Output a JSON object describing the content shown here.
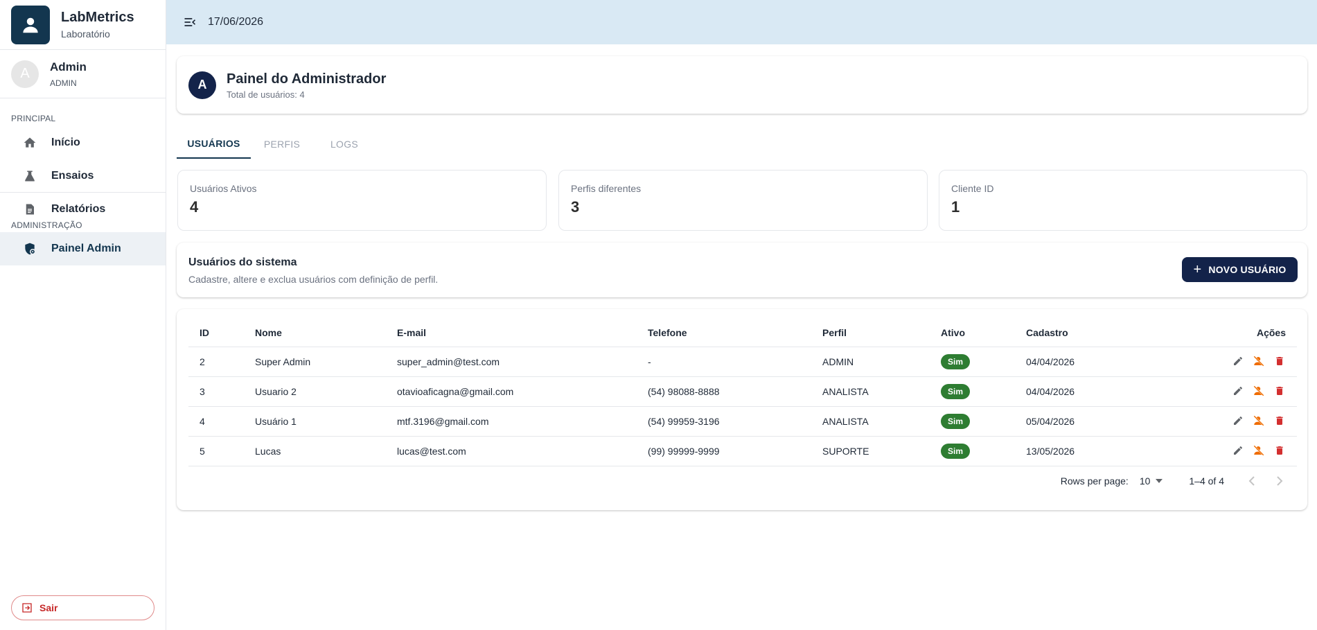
{
  "brand": {
    "title": "LabMetrics",
    "subtitle": "Laboratório",
    "icon": "person-icon"
  },
  "user": {
    "avatar_letter": "A",
    "name": "Admin",
    "role": "ADMIN"
  },
  "sidebar": {
    "sections": [
      {
        "title": "PRINCIPAL",
        "items": [
          {
            "label": "Início",
            "icon": "home-icon"
          },
          {
            "label": "Ensaios",
            "icon": "flask-icon"
          },
          {
            "label": "Relatórios",
            "icon": "document-icon"
          }
        ]
      },
      {
        "title": "ADMINISTRAÇÃO",
        "items": [
          {
            "label": "Painel Admin",
            "icon": "admin-shield-icon",
            "active": true
          }
        ]
      }
    ],
    "logout_label": "Sair"
  },
  "topbar": {
    "date": "17/06/2026"
  },
  "header": {
    "avatar_letter": "A",
    "title": "Painel do Administrador",
    "subtitle": "Total de usuários: 4"
  },
  "tabs": [
    {
      "label": "USUÁRIOS",
      "active": true
    },
    {
      "label": "PERFIS",
      "active": false
    },
    {
      "label": "LOGS",
      "active": false
    }
  ],
  "stats": [
    {
      "label": "Usuários Ativos",
      "value": "4"
    },
    {
      "label": "Perfis diferentes",
      "value": "3"
    },
    {
      "label": "Cliente ID",
      "value": "1"
    }
  ],
  "system_users": {
    "title": "Usuários do sistema",
    "subtitle": "Cadastre, altere e exclua usuários com definição de perfil.",
    "new_button": "NOVO USUÁRIO"
  },
  "table": {
    "headers": [
      "ID",
      "Nome",
      "E-mail",
      "Telefone",
      "Perfil",
      "Ativo",
      "Cadastro",
      "Ações"
    ],
    "rows": [
      {
        "id": "2",
        "nome": "Super Admin",
        "email": "super_admin@test.com",
        "telefone": "-",
        "perfil": "ADMIN",
        "ativo": "Sim",
        "cadastro": "04/04/2026"
      },
      {
        "id": "3",
        "nome": "Usuario 2",
        "email": "otavioaficagna@gmail.com",
        "telefone": "(54) 98088-8888",
        "perfil": "ANALISTA",
        "ativo": "Sim",
        "cadastro": "04/04/2026"
      },
      {
        "id": "4",
        "nome": "Usuário 1",
        "email": "mtf.3196@gmail.com",
        "telefone": "(54) 99959-3196",
        "perfil": "ANALISTA",
        "ativo": "Sim",
        "cadastro": "05/04/2026"
      },
      {
        "id": "5",
        "nome": "Lucas",
        "email": "lucas@test.com",
        "telefone": "(99) 99999-9999",
        "perfil": "SUPORTE",
        "ativo": "Sim",
        "cadastro": "13/05/2026"
      }
    ],
    "action_icons": [
      "edit-icon",
      "deactivate-user-icon",
      "delete-icon"
    ]
  },
  "pagination": {
    "rows_label": "Rows per page:",
    "rows_value": "10",
    "range": "1–4 of 4"
  },
  "colors": {
    "primary": "#13364f",
    "navy": "#13234a",
    "topbar": "#d9e9f4",
    "success": "#2e7d32",
    "danger": "#d32f2f",
    "warning": "#ef6c00"
  }
}
